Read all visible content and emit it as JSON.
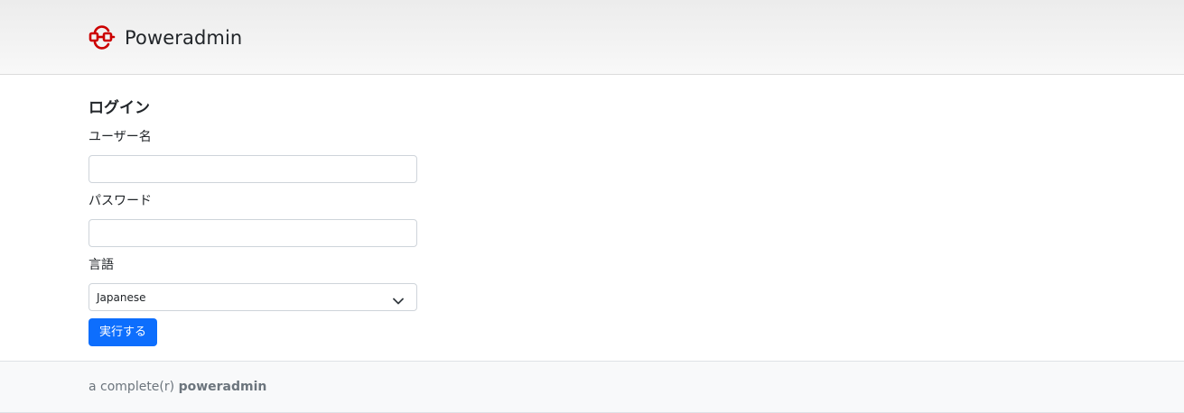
{
  "header": {
    "brand_name": "Poweradmin",
    "logo_icon": "poweradmin-logo-icon",
    "logo_color": "#cc0000"
  },
  "login": {
    "heading": "ログイン",
    "username_label": "ユーザー名",
    "username_value": "",
    "password_label": "パスワード",
    "password_value": "",
    "language_label": "言語",
    "language_selected": "Japanese",
    "submit_label": "実行する"
  },
  "footer": {
    "prefix": "a complete(r)",
    "brand": "poweradmin"
  },
  "colors": {
    "primary": "#0d6efd",
    "footer_bg": "#f8f9fa",
    "muted_text": "#6c757d"
  }
}
